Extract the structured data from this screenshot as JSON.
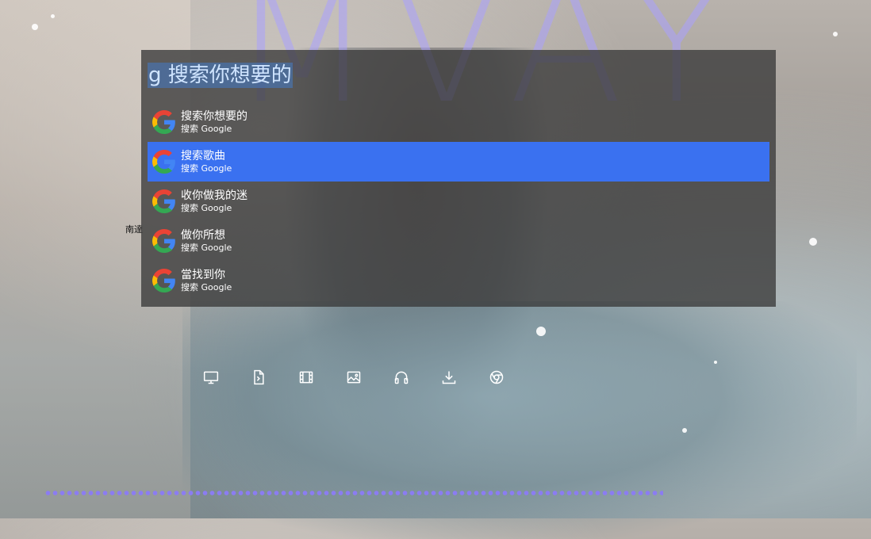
{
  "search": {
    "query": "g 搜索你想要的"
  },
  "suggestions": [
    {
      "text": "搜索你想要的",
      "source": "搜索 Google",
      "icon": "google-icon",
      "active": false
    },
    {
      "text": "搜索歌曲",
      "source": "搜索 Google",
      "icon": "google-icon",
      "active": true
    },
    {
      "text": "收你做我的迷",
      "source": "搜索 Google",
      "icon": "google-icon",
      "active": false
    },
    {
      "text": "做你所想",
      "source": "搜索 Google",
      "icon": "google-icon",
      "active": false
    },
    {
      "text": "當找到你",
      "source": "搜索 Google",
      "icon": "google-icon",
      "active": false
    }
  ],
  "desktop": {
    "partial_label": "南達"
  },
  "dock": [
    {
      "icon": "monitor-icon"
    },
    {
      "icon": "document-icon"
    },
    {
      "icon": "film-icon"
    },
    {
      "icon": "image-icon"
    },
    {
      "icon": "headphones-icon"
    },
    {
      "icon": "download-icon"
    },
    {
      "icon": "chrome-icon"
    }
  ],
  "colors": {
    "active_row": "#3a71f0",
    "visualizer": "#8b7cf2",
    "panel": "#3a3a3a"
  }
}
